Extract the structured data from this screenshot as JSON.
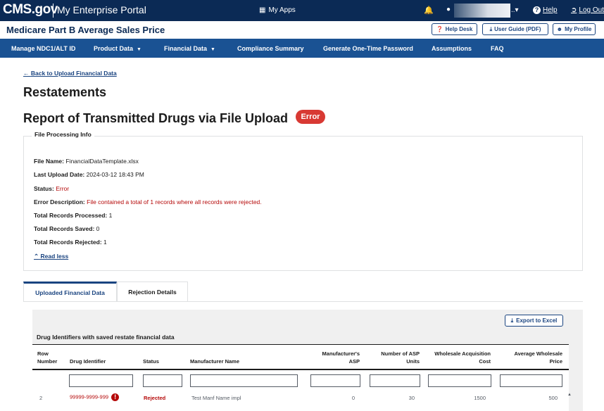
{
  "topbar": {
    "logo": "CMS.gov",
    "portal": "My Enterprise Portal",
    "my_apps": "My Apps",
    "user_ellipsis": "..▾",
    "help": "Help",
    "logout": "Log Out"
  },
  "header": {
    "app_title": "Medicare Part B Average Sales Price",
    "buttons": {
      "help_desk": "Help Desk",
      "user_guide": "User Guide (PDF)",
      "my_profile": "My Profile"
    }
  },
  "nav": {
    "items": [
      "Manage NDC1/ALT ID",
      "Product Data",
      "Financial Data",
      "Compliance Summary",
      "Generate One-Time Password",
      "Assumptions",
      "FAQ"
    ]
  },
  "page": {
    "back_link": "Back to Upload Financial Data",
    "title": "Restatements",
    "report_title": "Report of Transmitted Drugs via File Upload",
    "status_badge": "Error"
  },
  "file_info": {
    "legend": "File Processing Info",
    "rows": [
      {
        "label": "File Name:",
        "value": "FinancialDataTemplate.xlsx"
      },
      {
        "label": "Last Upload Date:",
        "value": "2024-03-12 18:43 PM"
      },
      {
        "label": "Status:",
        "value": "Error"
      },
      {
        "label": "Error Description:",
        "value": "File contained a total of 1 records where all records were rejected."
      },
      {
        "label": "Total Records Processed:",
        "value": "1"
      },
      {
        "label": "Total Records Saved:",
        "value": "0"
      },
      {
        "label": "Total Records Rejected:",
        "value": "1"
      }
    ],
    "read_less": "Read less"
  },
  "tabs": [
    "Uploaded Financial Data",
    "Rejection Details"
  ],
  "table": {
    "export_label": "Export to Excel",
    "caption": "Drug Identifiers with saved restate financial data",
    "headers": {
      "row_number_1": "Row",
      "row_number_2": "Number",
      "drug_identifier": "Drug Identifier",
      "status": "Status",
      "manufacturer_name": "Manufacturer Name",
      "manufacturer_asp_1": "Manufacturer's",
      "manufacturer_asp_2": "ASP",
      "asp_units_1": "Number of ASP",
      "asp_units_2": "Units",
      "wac_1": "Wholesale Acquisition",
      "wac_2": "Cost",
      "awp_1": "Average Wholesale",
      "awp_2": "Price"
    },
    "rows": [
      {
        "row_number": "2",
        "drug_identifier": "99999-9999-999",
        "status": "Rejected",
        "manufacturer_name": "Test Manf Name impl",
        "manufacturer_asp": "0",
        "asp_units": "30",
        "wac": "1500",
        "awp": "500"
      }
    ]
  },
  "icons": {
    "bell": "bell-icon",
    "user": "user-icon",
    "help": "question-circle-icon",
    "logout": "sign-out-icon",
    "download": "download-icon",
    "back": "arrow-left-icon",
    "chevron_up": "chevron-up-icon",
    "error": "exclamation-circle-icon"
  },
  "colors": {
    "topbar": "#0b2a55",
    "nav": "#1a5293",
    "link": "#1a4480",
    "error": "#d83933",
    "error_text": "#b50909"
  }
}
